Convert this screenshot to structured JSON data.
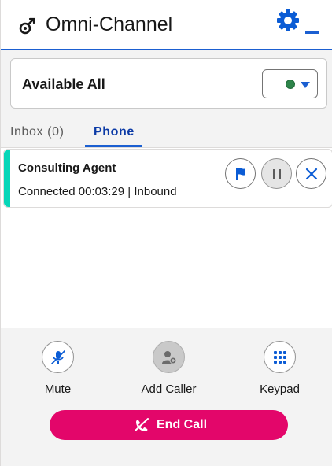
{
  "header": {
    "title": "Omni-Channel",
    "icon": "omni-channel-icon",
    "settings_icon": "gear-icon",
    "minimize_icon": "minimize-icon",
    "accent_color": "#1b5fd1"
  },
  "status": {
    "label": "Available All",
    "indicator_color": "#2e844a",
    "dropdown_icon": "caret-down-icon"
  },
  "tabs": [
    {
      "label": "Inbox (0)",
      "active": false
    },
    {
      "label": "Phone",
      "active": true
    }
  ],
  "work_item": {
    "name": "Consulting Agent",
    "details": "Connected 00:03:29 | Inbound",
    "stripe_color": "#06d6b8",
    "actions": [
      "flag-icon",
      "pause-icon",
      "close-icon"
    ]
  },
  "controls": {
    "mute_label": "Mute",
    "add_caller_label": "Add Caller",
    "keypad_label": "Keypad",
    "end_call_label": "End Call",
    "end_call_color": "#e3066a"
  }
}
